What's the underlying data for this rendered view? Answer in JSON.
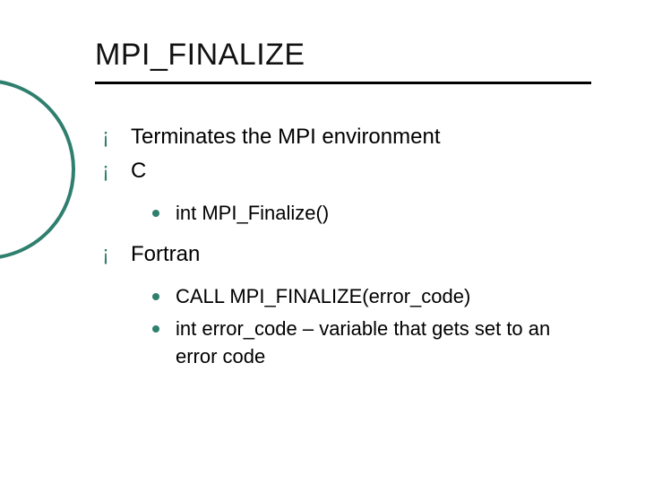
{
  "title": "MPI_FINALIZE",
  "bullets": {
    "b0": "Terminates the MPI environment",
    "b1": "C",
    "b1_sub": {
      "s0": "int MPI_Finalize()"
    },
    "b2": "Fortran",
    "b2_sub": {
      "s0": "CALL MPI_FINALIZE(error_code)",
      "s1": "int error_code – variable that gets set to an error code"
    }
  }
}
